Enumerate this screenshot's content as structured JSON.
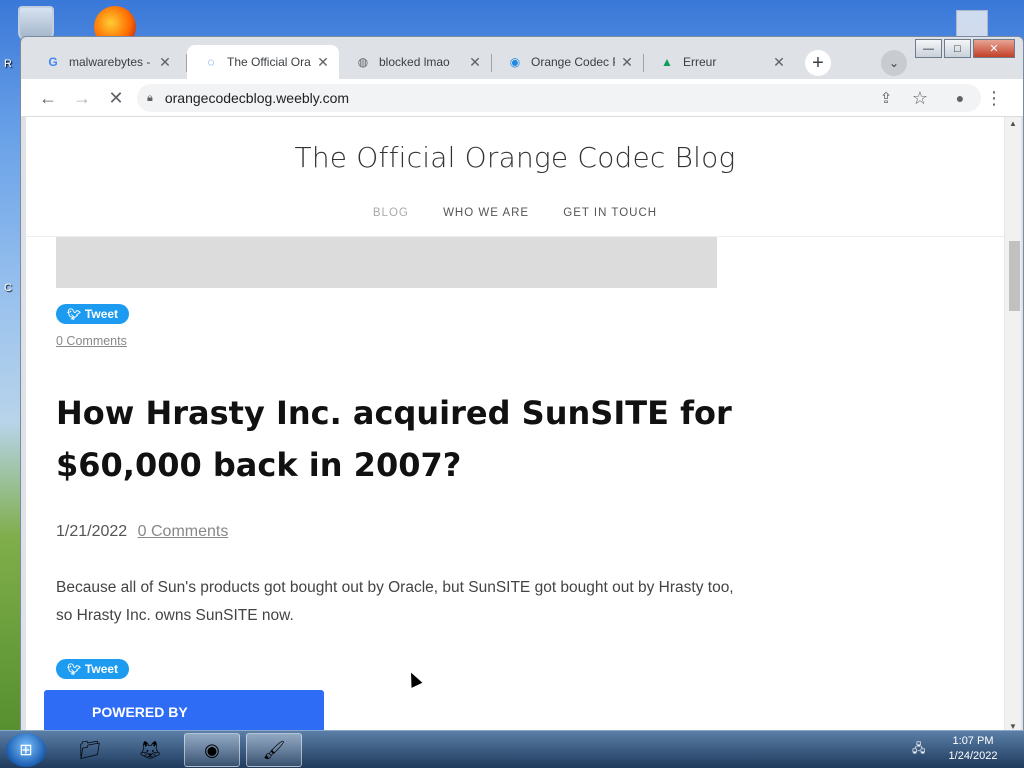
{
  "desktop": {
    "left_letters": [
      "R",
      "C"
    ]
  },
  "window": {
    "controls": {
      "minimize": "—",
      "maximize": "□",
      "close": "✕"
    }
  },
  "tabs": [
    {
      "title": "malwarebytes - Google",
      "favicon": "G",
      "active": false
    },
    {
      "title": "The Official Orange",
      "favicon": "◌",
      "active": true
    },
    {
      "title": "blocked lmao",
      "favicon": "◍",
      "active": false
    },
    {
      "title": "Orange Codec Player",
      "favicon": "◉",
      "active": false
    },
    {
      "title": "Erreur",
      "favicon": "▲",
      "active": false
    }
  ],
  "toolbar": {
    "back": "←",
    "forward": "→",
    "stop": "✕",
    "url": "orangecodecblog.weebly.com",
    "share": "⇪",
    "bookmark": "☆",
    "profile": "●",
    "menu": "⋮"
  },
  "site": {
    "title": "The Official Orange Codec Blog",
    "nav": [
      "BLOG",
      "WHO WE ARE",
      "GET IN TOUCH"
    ]
  },
  "posts": {
    "prev_tweet": "Tweet",
    "prev_comments": "0 Comments",
    "title": "How Hrasty Inc. acquired SunSITE for $60,000 back in 2007?",
    "date": "1/21/2022",
    "comments": "0 Comments",
    "body": "Because all of Sun's products got bought out by Oracle, but SunSITE got bought out by Hrasty too, so Hrasty Inc. owns SunSITE now.",
    "tweet": "Tweet"
  },
  "powered_by": "POWERED BY",
  "taskbar": {
    "apps": [
      "folder-icon",
      "firefox-icon",
      "chrome-icon",
      "paint-icon"
    ],
    "time": "1:07 PM",
    "date": "1/24/2022"
  }
}
